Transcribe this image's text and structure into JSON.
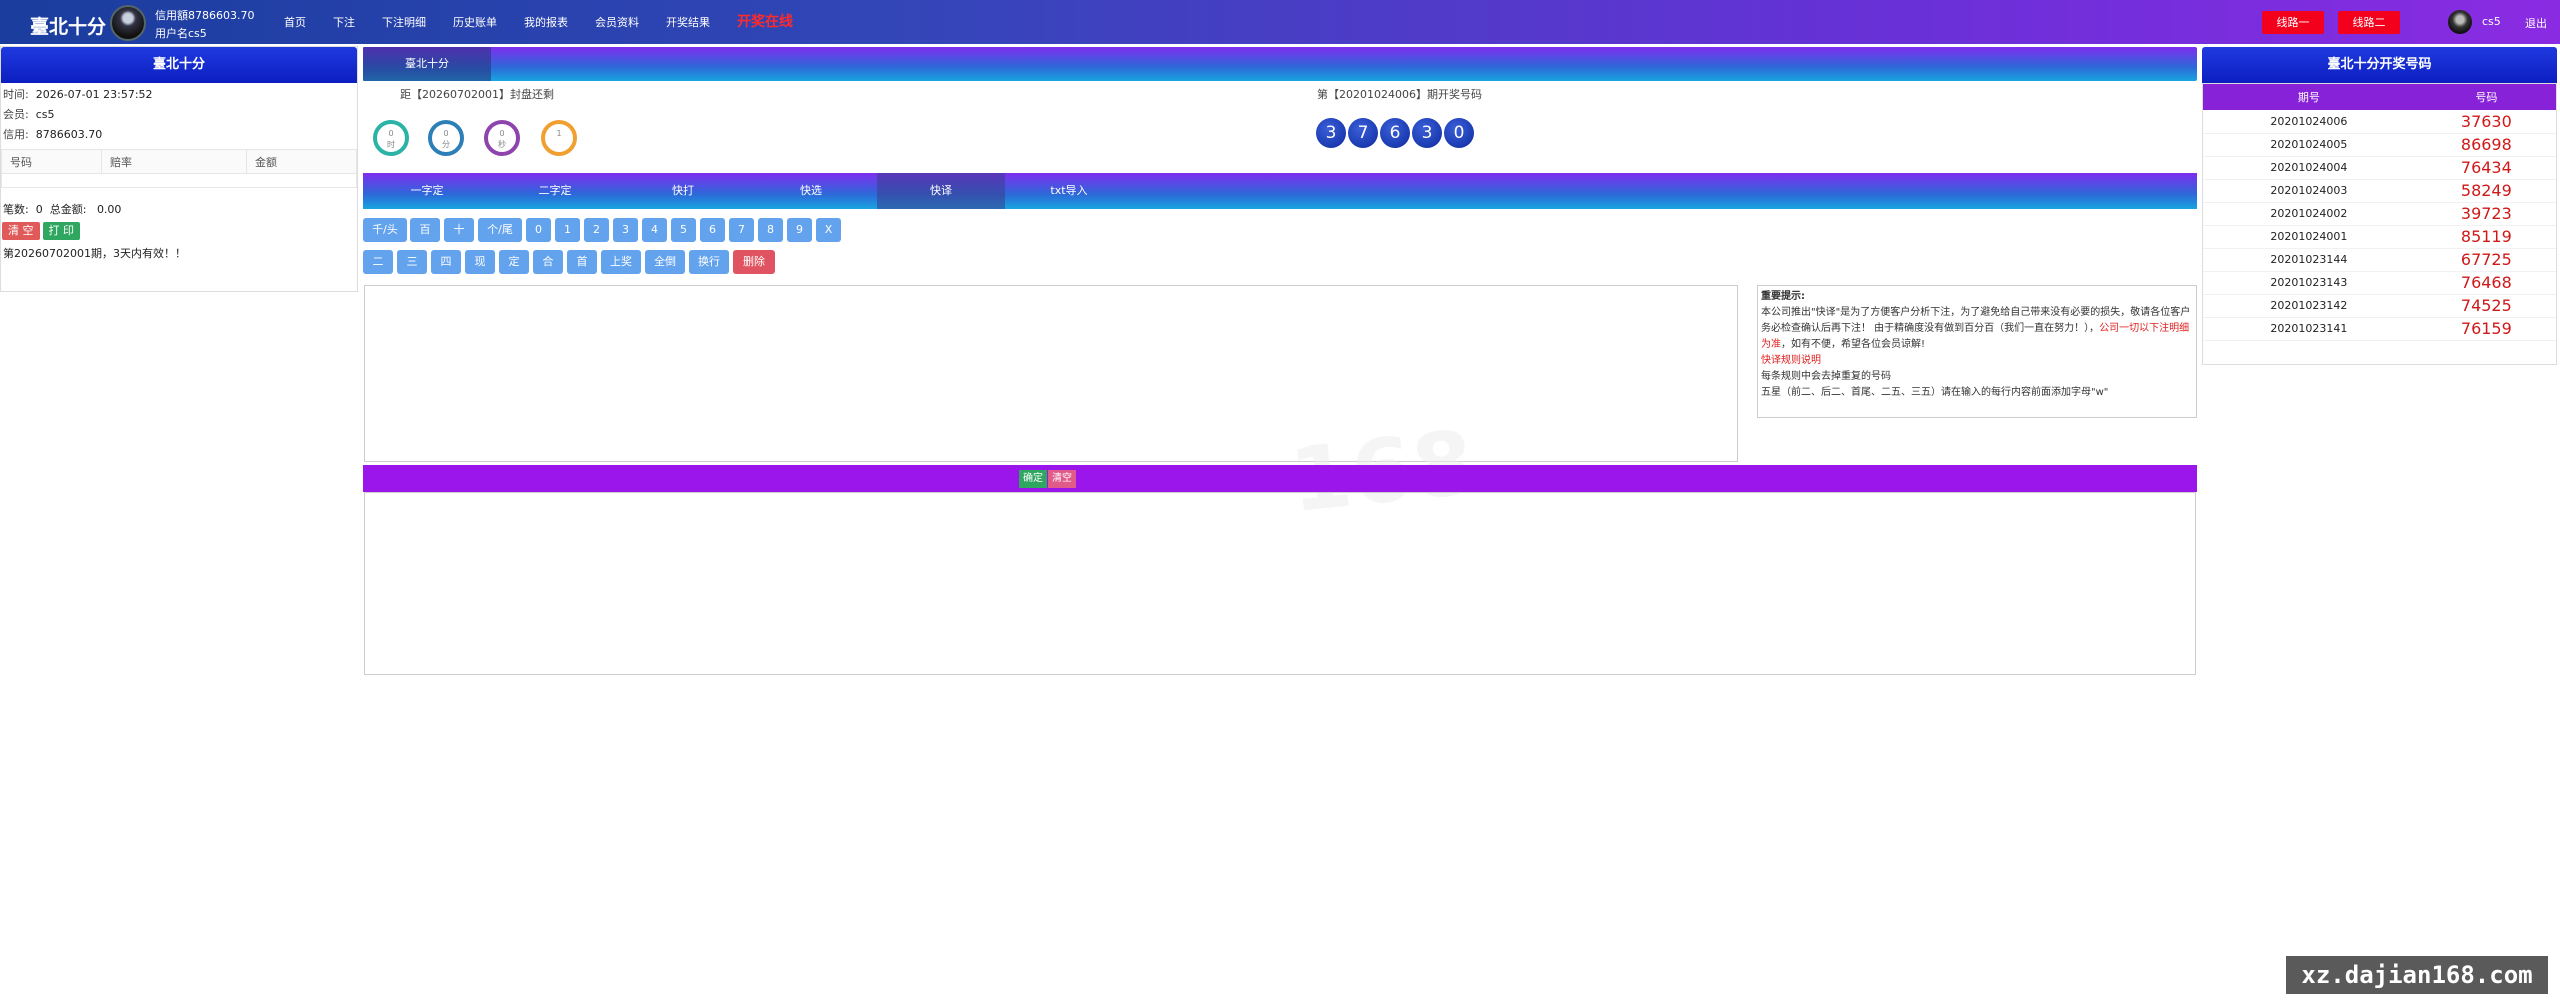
{
  "topbar": {
    "brand": "臺北十分",
    "credit_line": "信用額8786603.70",
    "user_line": "用户名cs5",
    "nav": [
      "首页",
      "下注",
      "下注明细",
      "历史账单",
      "我的报表",
      "会员资料",
      "开奖结果"
    ],
    "hot_link": "开奖在线",
    "line1": "线路一",
    "line2": "线路二",
    "username": "cs5",
    "logout": "退出"
  },
  "left_panel": {
    "title": "臺北十分",
    "time_label": "时间:",
    "time_value": "2026-07-01 23:57:52",
    "member_label": "会员:",
    "member_value": "cs5",
    "credit_label": "信用:",
    "credit_value": "8786603.70",
    "table_headers": [
      "号码",
      "赔率",
      "金额"
    ],
    "count_label": "笔数:",
    "count_value": "0",
    "total_label": "总金额:",
    "total_value": "0.00",
    "clear_btn": "清 空",
    "print_btn": "打 印",
    "notice": "第20260702001期，3天内有效！！"
  },
  "center": {
    "header_tab": "臺北十分",
    "close_countdown": "距【20260702001】封盘还剩",
    "circles": [
      {
        "top": "0",
        "bottom": "时",
        "color": "#2bb3a6"
      },
      {
        "top": "0",
        "bottom": "分",
        "color": "#2d7fb8"
      },
      {
        "top": "0",
        "bottom": "秒",
        "color": "#8e44ad"
      },
      {
        "top": "1",
        "bottom": "",
        "color": "#f0a030"
      }
    ],
    "draw_label": "第【20201024006】期开奖号码",
    "draw_balls": [
      "3",
      "7",
      "6",
      "3",
      "0"
    ],
    "tabs": [
      "一字定",
      "二字定",
      "快打",
      "快选",
      "快译",
      "txt导入"
    ],
    "active_tab": "快译",
    "keys_row1": [
      "千/头",
      "百",
      "十",
      "个/尾",
      "0",
      "1",
      "2",
      "3",
      "4",
      "5",
      "6",
      "7",
      "8",
      "9",
      "X"
    ],
    "keys_row2": [
      "二",
      "三",
      "四",
      "现",
      "定",
      "合",
      "首",
      "上奖",
      "全倒",
      "换行",
      "删除"
    ],
    "tips_title": "重要提示:",
    "tips_line1": "本公司推出\"快译\"是为了方便客户分析下注，为了避免给自己带来没有必要的损失，敬请各位客户务必检查确认后再下注！ 由于精确度没有做到百分百（我们一直在努力！），",
    "tips_red1": "公司一切以下注明细为准",
    "tips_line2": "，如有不便，希望各位会员谅解!",
    "tips_red2": "快译规则说明",
    "tips_line3": "每条规则中会去掉重复的号码",
    "tips_line4": "五星（前二、后二、首尾、二五、三五）请在输入的每行内容前面添加字母\"w\"",
    "confirm_btn": "确定",
    "clear_btn": "清空",
    "watermark": "168"
  },
  "right_panel": {
    "title": "臺北十分开奖号码",
    "headers": [
      "期号",
      "号码"
    ],
    "rows": [
      {
        "period": "20201024006",
        "number": "37630"
      },
      {
        "period": "20201024005",
        "number": "86698"
      },
      {
        "period": "20201024004",
        "number": "76434"
      },
      {
        "period": "20201024003",
        "number": "58249"
      },
      {
        "period": "20201024002",
        "number": "39723"
      },
      {
        "period": "20201024001",
        "number": "85119"
      },
      {
        "period": "20201023144",
        "number": "67725"
      },
      {
        "period": "20201023143",
        "number": "76468"
      },
      {
        "period": "20201023142",
        "number": "74525"
      },
      {
        "period": "20201023141",
        "number": "76159"
      }
    ]
  },
  "site_mark": "xz.dajian168.com"
}
